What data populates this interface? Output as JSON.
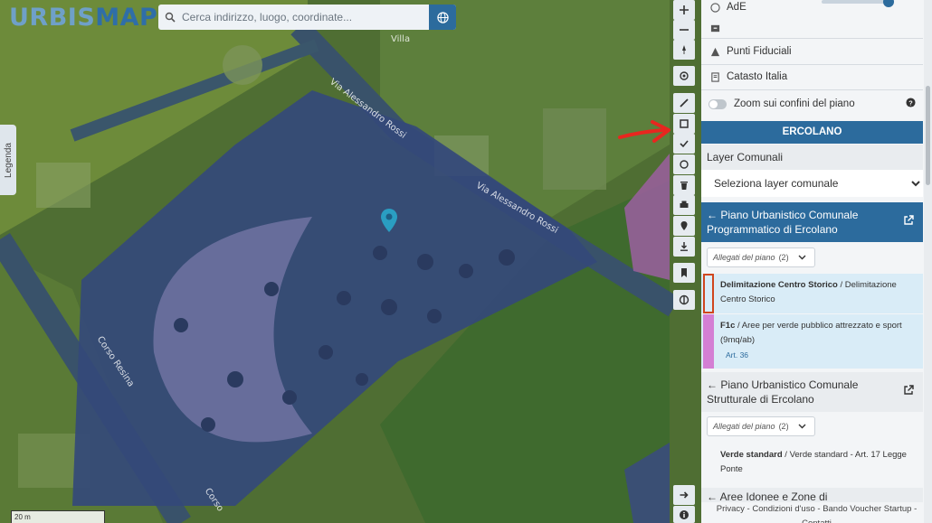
{
  "app": {
    "logo_part1": "URBIS",
    "logo_part2": "MAP"
  },
  "search": {
    "placeholder": "Cerca indirizzo, luogo, coordinate..."
  },
  "legend_tab": {
    "label": "Legenda"
  },
  "map": {
    "street_labels": [
      "Corso Resina",
      "Via Alessandro Rossi",
      "Via Alessandro Rossi",
      "Villa",
      "Corso"
    ],
    "scale_label": "20 m"
  },
  "toolbar": {
    "icons": [
      "zoom-in-icon",
      "zoom-out-icon",
      "compass-icon",
      "locate-icon",
      "measure-line-icon",
      "measure-area-icon",
      "draw-line-icon",
      "circle-icon",
      "trash-icon",
      "print-icon",
      "marker-icon",
      "download-icon",
      "bookmark-icon",
      "layers-icon",
      "arrow-right-icon",
      "info-icon"
    ]
  },
  "panel": {
    "ade_label": "AdE",
    "punti_fiduciali": "Punti Fiduciali",
    "catasto": "Catasto Italia",
    "zoom_confini": "Zoom sui confini del piano",
    "comune_title": "ERCOLANO",
    "layer_comunali": "Layer Comunali",
    "select_layer": "Seleziona layer comunale",
    "plan1": {
      "title": "Piano Urbanistico Comunale Programmatico di Ercolano",
      "allegati_label": "Allegati del piano",
      "allegati_count": "(2)",
      "items": [
        {
          "name": "Delimitazione Centro Storico",
          "desc": "Delimitazione Centro Storico",
          "color": "#d9ecf7",
          "border": "#d0461e"
        },
        {
          "name": "F1c",
          "desc": "Aree per verde pubblico attrezzato e sport (9mq/ab)",
          "art": "Art. 36",
          "color": "#d47fd4"
        }
      ]
    },
    "plan2": {
      "title": "Piano Urbanistico Comunale Strutturale di Ercolano",
      "allegati_label": "Allegati del piano",
      "allegati_count": "(2)",
      "item_name": "Verde standard",
      "item_desc": "Verde standard - Art. 17 Legge Ponte"
    },
    "plan3": {
      "title": "Aree Idonee e Zone di"
    },
    "footer": "Privacy - Condizioni d'uso - Bando Voucher Startup - Contatti"
  },
  "colors": {
    "accent": "#2c6b9d",
    "highlight_border": "#d0461e",
    "arrow": "#e8261f"
  }
}
